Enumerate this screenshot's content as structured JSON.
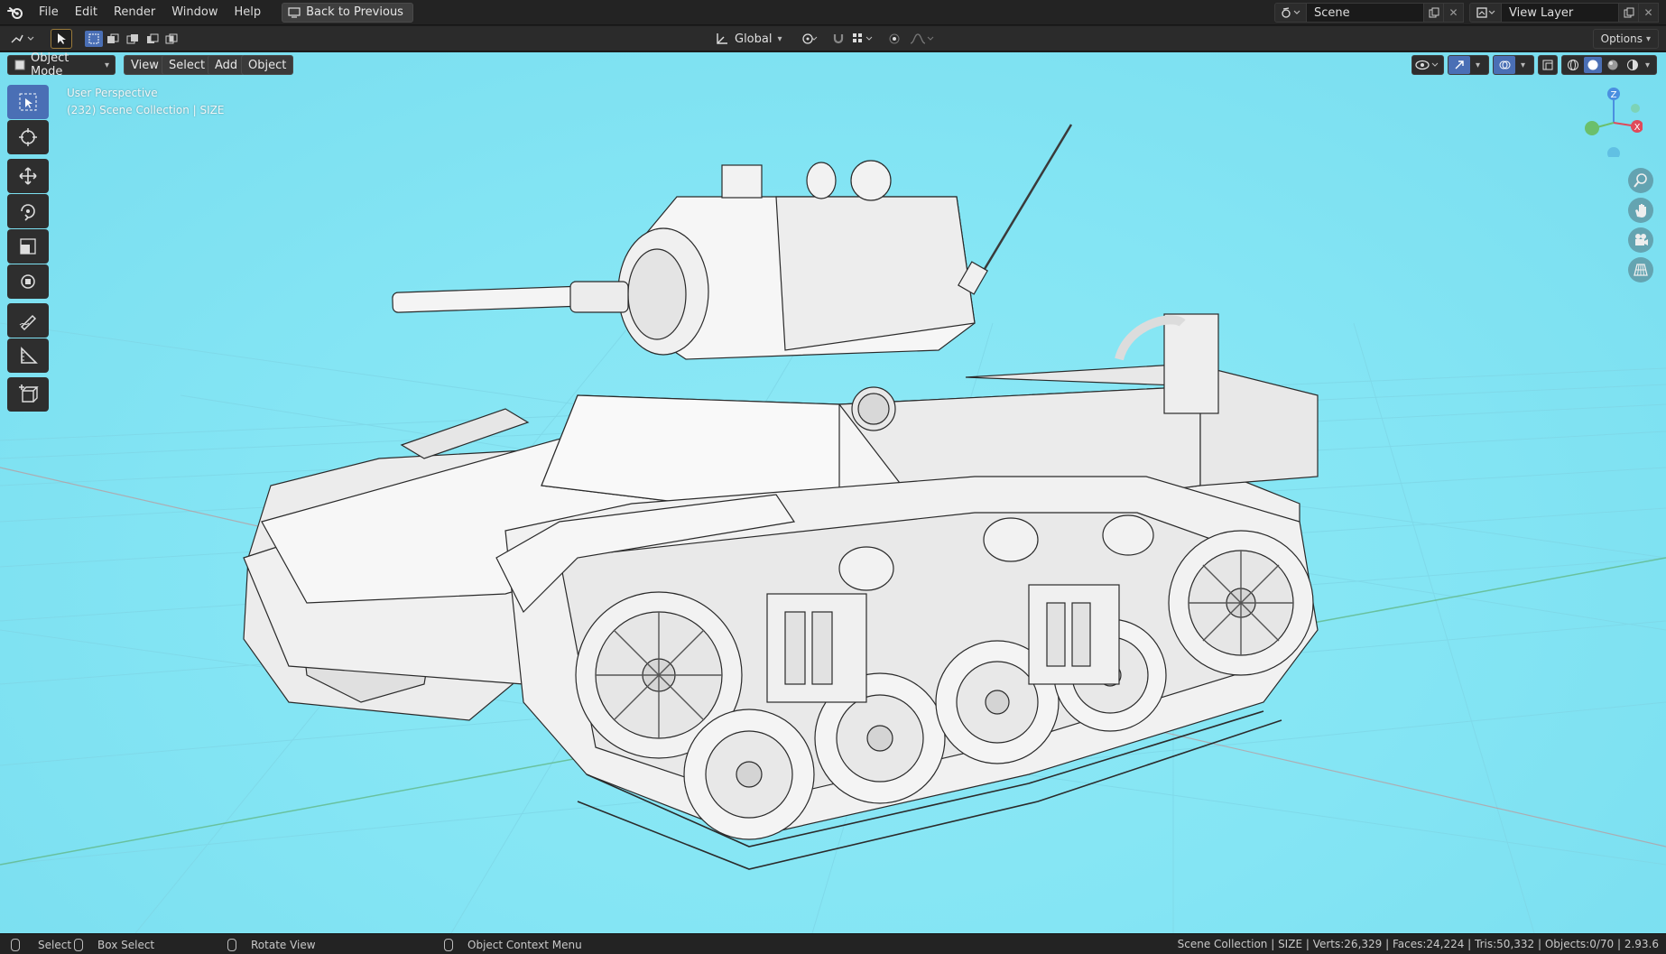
{
  "topbar": {
    "menu": [
      "File",
      "Edit",
      "Render",
      "Window",
      "Help"
    ],
    "back_button": "Back to Previous",
    "scene": "Scene",
    "view_layer": "View Layer"
  },
  "toolheader": {
    "orientation": "Global",
    "options": "Options"
  },
  "viewport": {
    "mode": "Object Mode",
    "menus": [
      "View",
      "Select",
      "Add",
      "Object"
    ],
    "perspective_label": "User Perspective",
    "collection_label": "(232) Scene Collection | SIZE",
    "gizmo_axes": {
      "z": "Z",
      "x": "X",
      "y": "Y"
    },
    "background_color": "#86e6f5"
  },
  "toolbar": {
    "tools": [
      "select-box",
      "cursor",
      "move",
      "rotate",
      "scale",
      "transform",
      "annotate",
      "measure",
      "add-cube"
    ]
  },
  "statusbar": {
    "select": "Select",
    "box_select": "Box Select",
    "rotate_view": "Rotate View",
    "context_menu": "Object Context Menu",
    "stats": "Scene Collection | SIZE | Verts:26,329 | Faces:24,224 | Tris:50,332 | Objects:0/70 | 2.93.6"
  }
}
